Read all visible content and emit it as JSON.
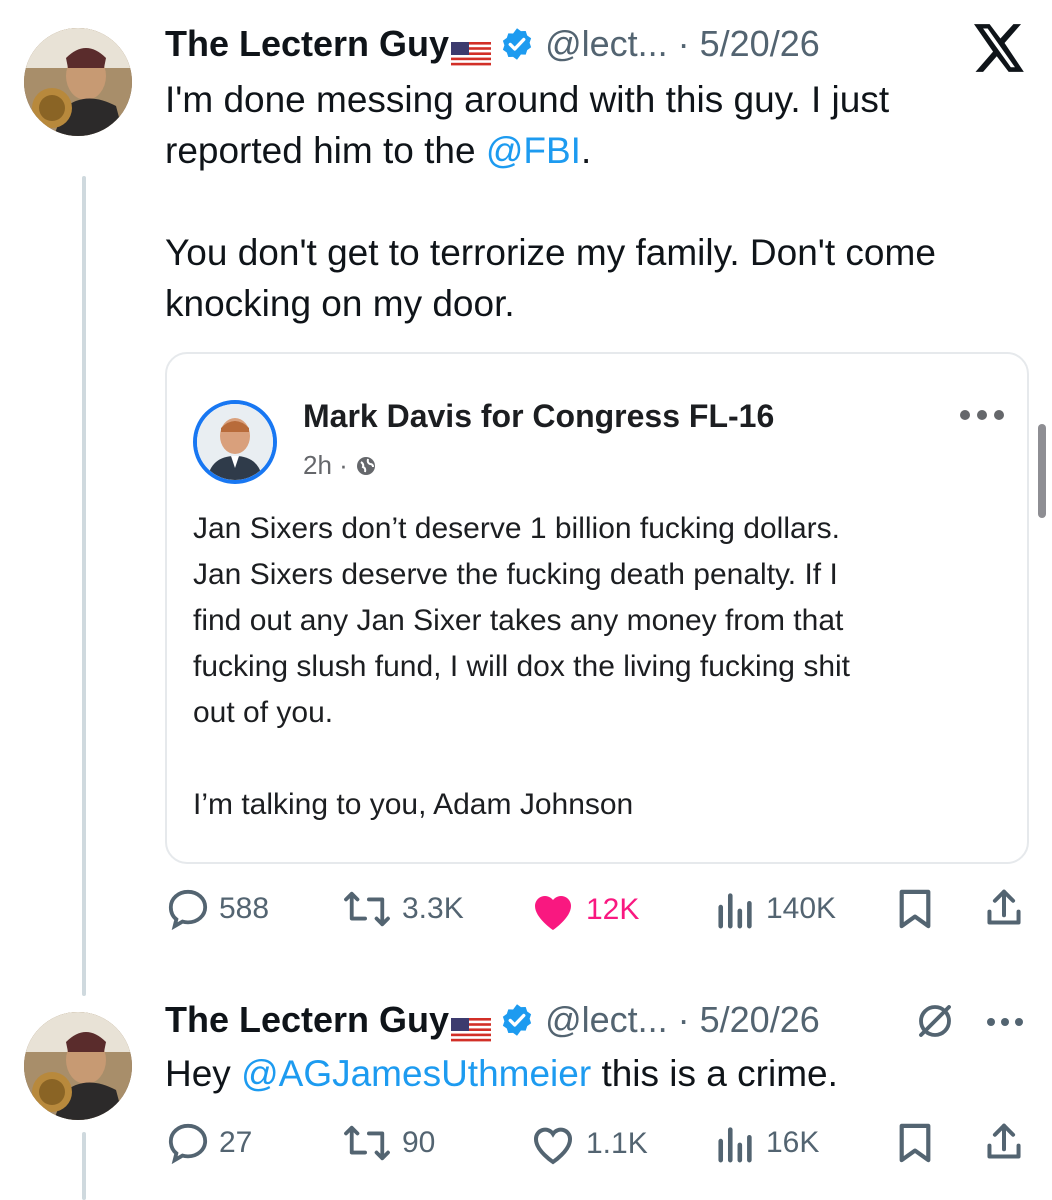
{
  "tweet1": {
    "name": "The Lectern Guy",
    "handle_date": "@lect... · 5/20/26",
    "text_part1": "I'm done messing around with this guy. I just\nreported him to the ",
    "mention": "@FBI",
    "text_part2": ".\n\nYou don't get to terrorize my family. Don't come\nknocking on my door.",
    "quoted": {
      "name": "Mark Davis for Congress FL-16",
      "time": "2h ·",
      "text": "Jan Sixers don’t deserve 1 billion fucking dollars.\nJan Sixers deserve the fucking death penalty. If I\nfind out any Jan Sixer takes any money from that\nfucking slush fund, I will dox the living fucking shit\nout of you.\n\nI’m talking to you, Adam Johnson"
    },
    "stats": {
      "replies": "588",
      "reposts": "3.3K",
      "likes": "12K",
      "views": "140K"
    }
  },
  "tweet2": {
    "name": "The Lectern Guy",
    "handle_date": "@lect... · 5/20/26",
    "text_part1": "Hey ",
    "mention": "@AGJamesUthmeier",
    "text_part2": " this is a crime.",
    "stats": {
      "replies": "27",
      "reposts": "90",
      "likes": "1.1K",
      "views": "16K"
    }
  },
  "colors": {
    "accent": "#1d9bf0",
    "like": "#f91880",
    "verified": "#1d9bf0",
    "muted": "#536471"
  },
  "icons": [
    "x-logo-icon",
    "verified-badge-icon",
    "us-flag-icon",
    "more-icon",
    "globe-icon",
    "reply-icon",
    "repost-icon",
    "heart-icon",
    "views-icon",
    "bookmark-icon",
    "share-icon",
    "grok-icon"
  ]
}
